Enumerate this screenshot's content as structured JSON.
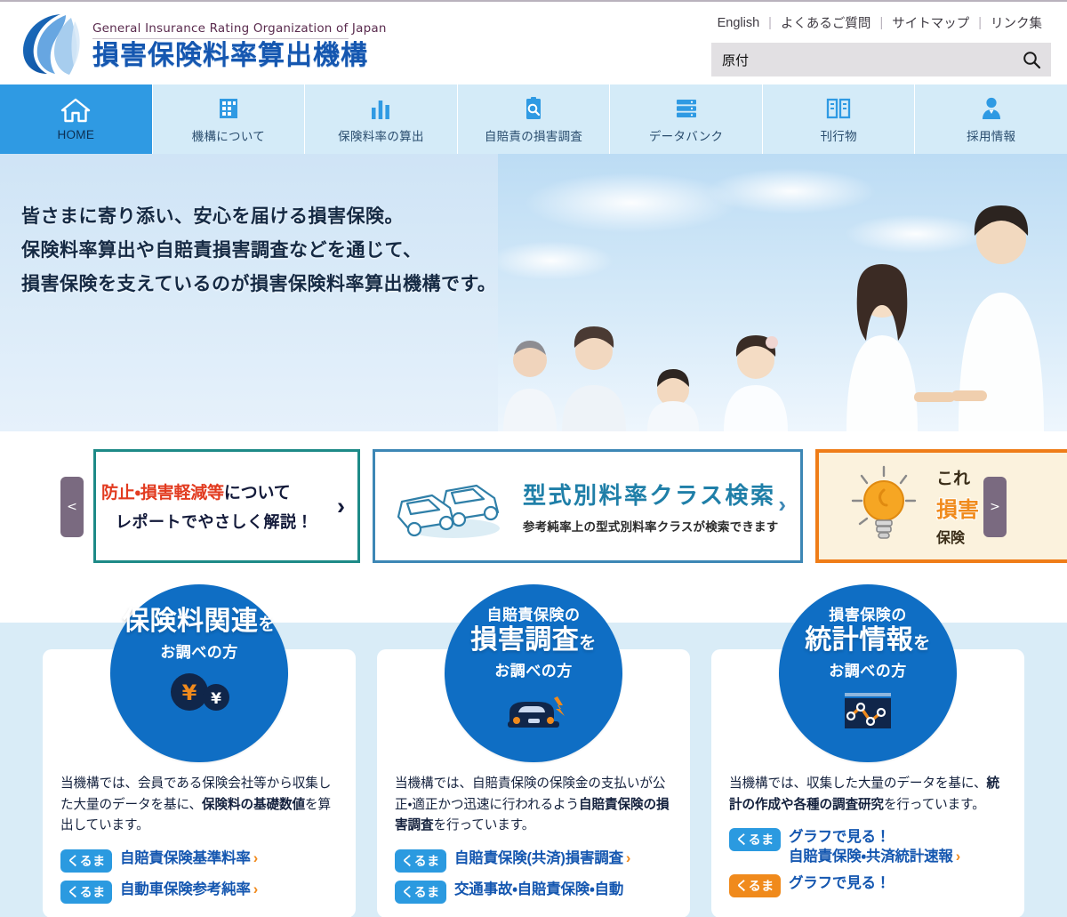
{
  "header": {
    "logo_en": "General Insurance Rating Organization of Japan",
    "logo_jp": "損害保険料率算出機構",
    "logo_icon": "swoosh-globe-logo",
    "top_links": [
      {
        "label": "English"
      },
      {
        "label": "よくあるご質問"
      },
      {
        "label": "サイトマップ"
      },
      {
        "label": "リンク集"
      }
    ],
    "separator": "|",
    "search": {
      "value": "原付",
      "placeholder": "",
      "icon": "search-icon"
    }
  },
  "global_nav": {
    "items": [
      {
        "label": "HOME",
        "icon": "home-icon",
        "active": true
      },
      {
        "label": "機構について",
        "icon": "building-icon",
        "active": false
      },
      {
        "label": "保険料率の算出",
        "icon": "bar-chart-icon",
        "active": false
      },
      {
        "label": "自賠責の損害調査",
        "icon": "clipboard-search-icon",
        "active": false
      },
      {
        "label": "データバンク",
        "icon": "database-icon",
        "active": false
      },
      {
        "label": "刊行物",
        "icon": "book-icon",
        "active": false
      },
      {
        "label": "採用情報",
        "icon": "person-icon",
        "active": false
      }
    ]
  },
  "hero": {
    "lines": [
      "皆さまに寄り添い、安心を届ける損害保険。",
      "保険料率算出や自賠責損害調査などを通じて、",
      "損害保険を支えているのが損害保険料率算出機構です。"
    ],
    "photo_alt": "family-photo"
  },
  "carousel": {
    "prev_label": "<",
    "next_label": ">",
    "slides": [
      {
        "id": "slide-prevention",
        "line1_red": "防止・損害軽減等",
        "line1_rest": "について",
        "line2": "レポートでやさしく解説！",
        "chevron": "›"
      },
      {
        "id": "slide-class-search",
        "title": "型式別料率クラス検索",
        "subtitle": "参考純率上の型式別料率クラスが検索できます",
        "icon": "two-cars-icon",
        "chevron": "›"
      },
      {
        "id": "slide-insurance-tips",
        "line1": "これ",
        "line2": "損害",
        "line3": "保険",
        "icon": "lightbulb-icon"
      }
    ]
  },
  "features": {
    "cards": [
      {
        "circle_small": "",
        "circle_big": "保険料関連",
        "circle_suffix": "を",
        "circle_sub": "お調べの方",
        "icon": "yen-coins-icon",
        "body_pre": "当機構では、会員である保険会社等から収集した大量のデータを基に、",
        "body_bold": "保険料の基礎数値",
        "body_post": "を算出しています。",
        "links": [
          {
            "tag": "くるま",
            "tag_color": "blue",
            "text": "自賠責保険基準料率",
            "arrow": "›"
          },
          {
            "tag": "くるま",
            "tag_color": "blue",
            "text": "自動車保険参考純率",
            "arrow": "›"
          }
        ]
      },
      {
        "circle_small": "自賠責保険の",
        "circle_big": "損害調査",
        "circle_suffix": "を",
        "circle_sub": "お調べの方",
        "icon": "car-crash-icon",
        "body_pre": "当機構では、自賠責保険の保険金の支払いが公正・適正かつ迅速に行われるよう",
        "body_bold": "自賠責保険の損害調査",
        "body_post": "を行っています。",
        "links": [
          {
            "tag": "くるま",
            "tag_color": "blue",
            "text": "自賠責保険(共済)損害調査",
            "arrow": "›"
          },
          {
            "tag": "くるま",
            "tag_color": "blue",
            "text": "交通事故・自賠責保険・自動",
            "arrow": ""
          }
        ]
      },
      {
        "circle_small": "損害保険の",
        "circle_big": "統計情報",
        "circle_suffix": "を",
        "circle_sub": "お調べの方",
        "icon": "line-chart-icon",
        "body_pre": "当機構では、収集した大量のデータを基に、",
        "body_bold": "統計の作成や各種の調査研究",
        "body_post": "を行っています。",
        "links": [
          {
            "tag": "くるま",
            "tag_color": "blue",
            "text": "グラフで見る！\n自賠責保険・共済統計速報",
            "arrow": "›"
          },
          {
            "tag": "くるま",
            "tag_color": "orange",
            "text": "グラフで見る！",
            "arrow": ""
          }
        ]
      }
    ]
  },
  "colors": {
    "brand_blue": "#1557b0",
    "nav_active": "#2f9ae3",
    "nav_bg": "#d4ebf8",
    "circle_blue": "#0f6ec4",
    "accent_orange": "#f08a1c",
    "band_blue": "#d9ecf7",
    "tag_blue": "#2b9ae0"
  }
}
